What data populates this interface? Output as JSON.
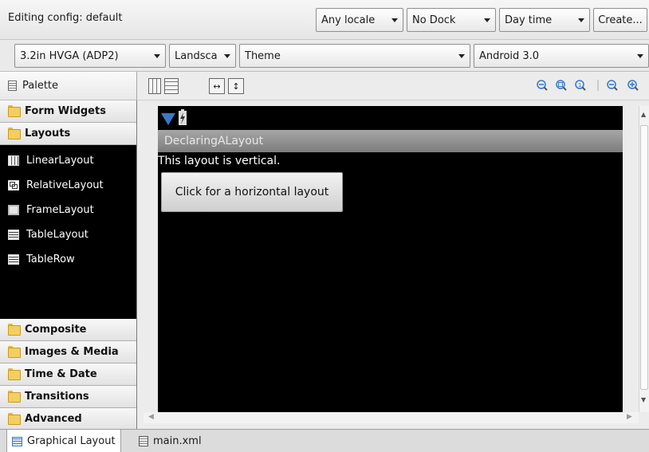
{
  "toolbar": {
    "config_label": "Editing config: default",
    "locale": "Any locale",
    "dock": "No Dock",
    "time": "Day time",
    "create_label": "Create...",
    "device": "3.2in HVGA (ADP2)",
    "orientation": "Landsca",
    "theme": "Theme",
    "api": "Android 3.0"
  },
  "palette": {
    "title": "Palette",
    "categories_top": [
      "Form Widgets",
      "Layouts"
    ],
    "layout_items": [
      "LinearLayout",
      "RelativeLayout",
      "FrameLayout",
      "TableLayout",
      "TableRow"
    ],
    "categories_bottom": [
      "Composite",
      "Images & Media",
      "Time & Date",
      "Transitions",
      "Advanced"
    ]
  },
  "device": {
    "app_title": "DeclaringALayout",
    "text_line": "This layout is vertical.",
    "button_label": "Click for a horizontal layout"
  },
  "tabs": {
    "graphical": "Graphical Layout",
    "xml": "main.xml"
  },
  "colors": {
    "accent_blue": "#3b79c6",
    "title_gray": "#8f8f8f",
    "folder_yellow": "#f3cf62"
  }
}
